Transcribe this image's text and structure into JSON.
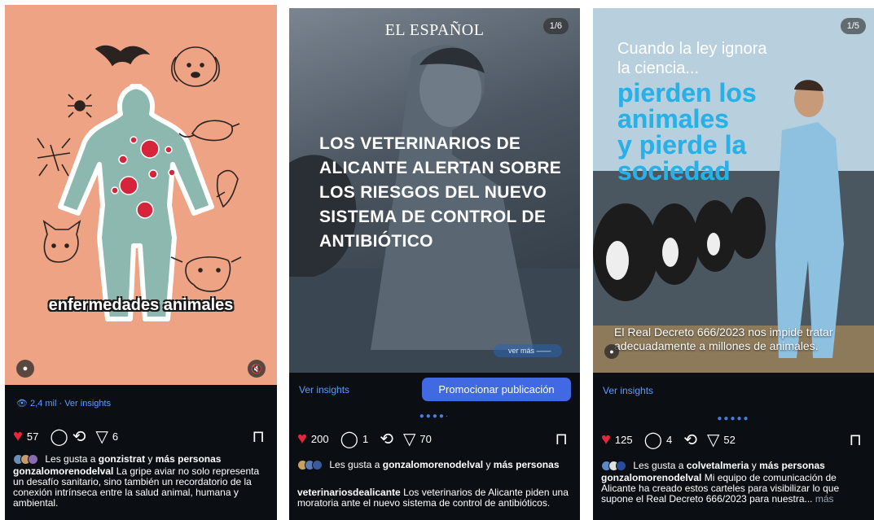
{
  "panel1": {
    "caption_overlay": "enfermedades animales",
    "insights": "2,4 mil · Ver insights",
    "likes_count": "57",
    "shares_count": "6",
    "liked_by_prefix": "Les gusta a",
    "liked_by_user": "gonzistrat",
    "liked_by_join": "y",
    "liked_by_more": "más personas",
    "author": "gonzalomorenodelval",
    "caption_text": "La gripe aviar no solo representa un desafío sanitario, sino también un recordatorio de la conexión intrínseca entre la salud animal, humana y ambiental."
  },
  "panel2": {
    "brand": "EL ESPAÑOL",
    "counter": "1/6",
    "headline": "LOS VETERINARIOS DE ALICANTE ALERTAN SOBRE LOS RIESGOS DEL NUEVO SISTEMA DE CONTROL DE ANTIBIÓTICO",
    "ver_mas": "ver más",
    "insights": "Ver insights",
    "promote": "Promocionar publicación",
    "likes_count": "200",
    "comments_count": "1",
    "shares_count": "70",
    "liked_by_prefix": "Les gusta a",
    "liked_by_user": "gonzalomorenodelval",
    "liked_by_join": "y",
    "liked_by_more": "más personas",
    "author": "veterinariosdealicante",
    "caption_text": "Los veterinarios de Alicante piden una moratoria ante el nuevo sistema de control de antibióticos."
  },
  "panel3": {
    "counter": "1/5",
    "line1": "Cuando la ley ignora la ciencia...",
    "big1": "pierden los",
    "big2": "animales",
    "big3": "y pierde la",
    "big4": "sociedad",
    "bottom": "El Real Decreto 666/2023 nos impide tratar adecuadamente a millones de animales.",
    "insights": "Ver insights",
    "likes_count": "125",
    "comments_count": "4",
    "shares_count": "52",
    "liked_by_prefix": "Les gusta a",
    "liked_by_user": "colvetalmeria",
    "liked_by_join": "y",
    "liked_by_more": "más personas",
    "author": "gonzalomorenodelval",
    "caption_text": "Mi equipo de comunicación de Alicante ha creado estos carteles para visibilizar lo que supone el Real Decreto 666/2023 para nuestra...",
    "more": "más"
  },
  "colors": {
    "heart": "#e8253b",
    "link": "#5b9cff",
    "promote": "#4169e1",
    "panel_bg": "#0b0f14"
  }
}
